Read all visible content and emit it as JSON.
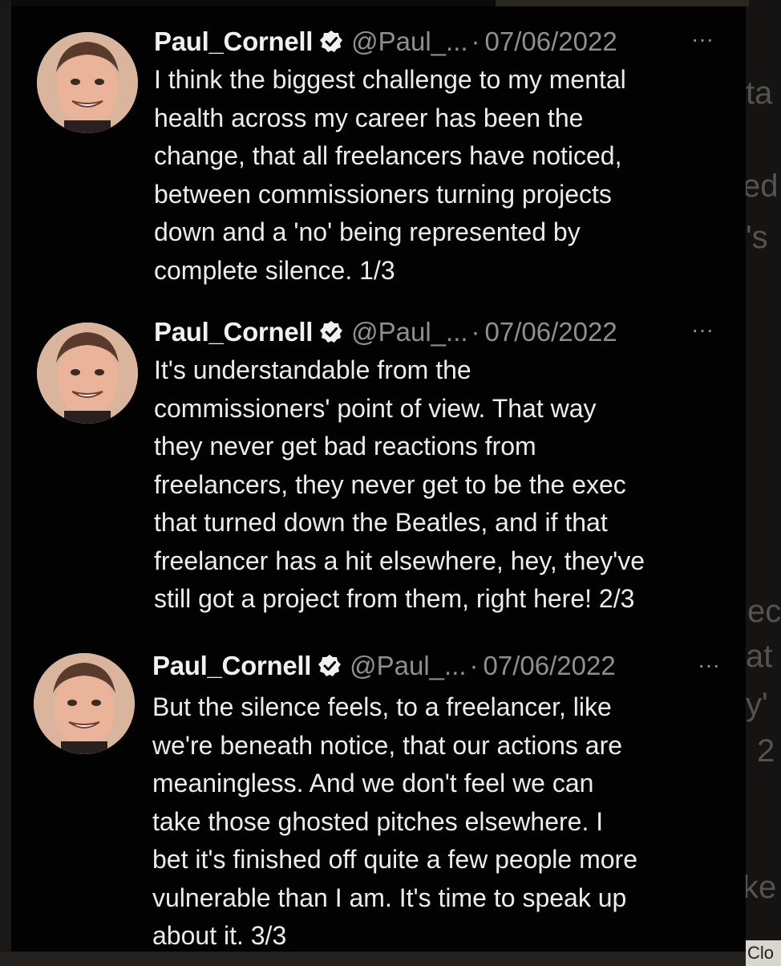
{
  "tweets": [
    {
      "display_name": "Paul_Cornell",
      "handle": "@Paul_...",
      "separator": "·",
      "date": "07/06/2022",
      "more": "···",
      "text": "I think the biggest challenge to my mental\nhealth across my career has been the\nchange, that all freelancers have noticed,\nbetween commissioners turning projects\ndown and a 'no' being represented by\ncomplete silence.  1/3"
    },
    {
      "display_name": "Paul_Cornell",
      "handle": "@Paul_...",
      "separator": "·",
      "date": "07/06/2022",
      "more": "···",
      "text": "It's understandable from the\ncommissioners' point of view. That way\nthey never get bad reactions from\nfreelancers, they never get to be the exec\nthat turned down the Beatles, and if that\nfreelancer has a hit elsewhere, hey, they've\nstill got a project from them, right here! 2/3"
    },
    {
      "display_name": "Paul_Cornell",
      "handle": "@Paul_...",
      "separator": "·",
      "date": "07/06/2022",
      "more": "···",
      "text": "But the silence feels, to a freelancer, like\nwe're beneath notice, that our actions are\nmeaningless.  And we don't feel we can\ntake those ghosted pitches elsewhere.  I\nbet it's finished off quite a few people more\nvulnerable than I am.  It's time to speak up\nabout it.  3/3"
    }
  ],
  "background_fragments": [
    "ta",
    "ed,",
    "'s",
    "ec",
    "at",
    "y'",
    "2",
    "ke"
  ],
  "close_button_label": "Clo",
  "colors": {
    "panel_bg": "#020202",
    "name_text": "#f1f1f1",
    "body_text": "#ececec",
    "muted_text": "#8f8f8f",
    "verified_badge": "#f1f1f1"
  },
  "icons": {
    "verified": "verified-badge-icon",
    "more": "more-options-icon",
    "avatar": "profile-photo"
  }
}
